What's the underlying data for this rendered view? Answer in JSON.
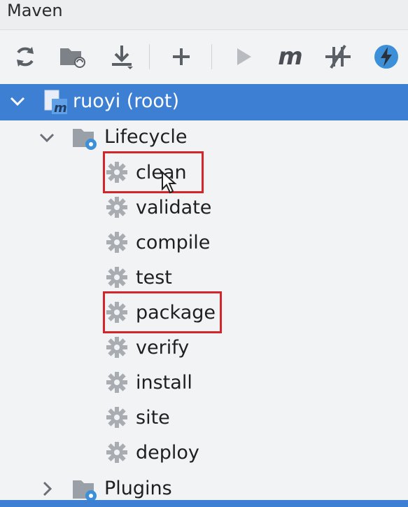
{
  "window": {
    "title": "Maven"
  },
  "toolbar": {
    "buttons": [
      {
        "name": "reload-icon"
      },
      {
        "name": "add-project-folder-icon"
      },
      {
        "name": "download-icon"
      },
      {
        "name": "plus-icon"
      },
      {
        "name": "run-icon"
      },
      {
        "name": "maven-m-icon"
      },
      {
        "name": "skip-tests-icon"
      },
      {
        "name": "lightning-icon"
      }
    ]
  },
  "tree": {
    "root": {
      "label": "ruoyi (root)"
    },
    "lifecycle": {
      "label": "Lifecycle",
      "items": [
        {
          "label": "clean",
          "highlighted": true
        },
        {
          "label": "validate",
          "highlighted": false
        },
        {
          "label": "compile",
          "highlighted": false
        },
        {
          "label": "test",
          "highlighted": false
        },
        {
          "label": "package",
          "highlighted": true
        },
        {
          "label": "verify",
          "highlighted": false
        },
        {
          "label": "install",
          "highlighted": false
        },
        {
          "label": "site",
          "highlighted": false
        },
        {
          "label": "deploy",
          "highlighted": false
        }
      ]
    },
    "plugins": {
      "label": "Plugins"
    }
  },
  "colors": {
    "selection": "#3d7fd3",
    "highlight_box": "#d4262a",
    "gear": "#a9adb2",
    "background": "#f2f3f5"
  }
}
